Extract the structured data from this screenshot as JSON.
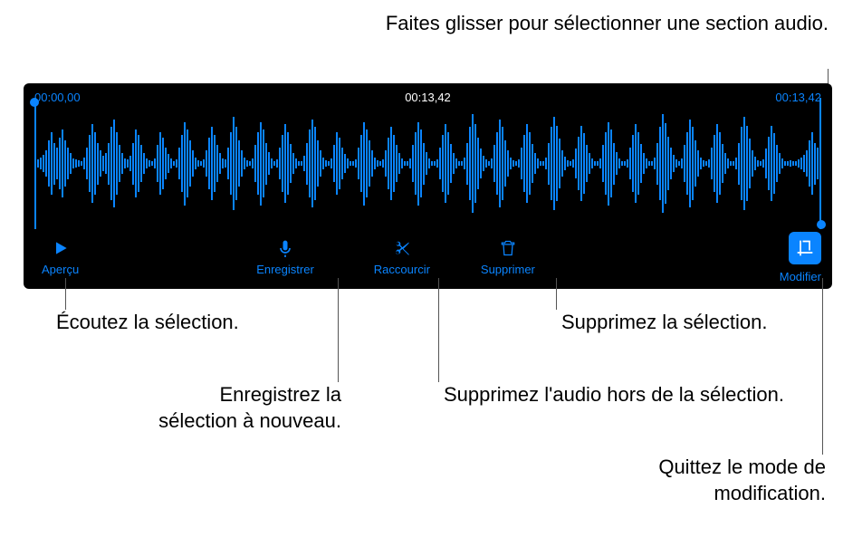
{
  "annotations": {
    "drag_select": "Faites glisser pour sélectionner une section audio.",
    "listen": "Écoutez la sélection.",
    "record_again": "Enregistrez la sélection à nouveau.",
    "delete_outside": "Supprimez l'audio hors de la sélection.",
    "delete_selection": "Supprimez la sélection.",
    "exit_edit": "Quittez le mode de modification."
  },
  "timeline": {
    "start": "00:00,00",
    "current": "00:13,42",
    "end": "00:13,42"
  },
  "toolbar": {
    "apercu": "Aperçu",
    "enregistrer": "Enregistrer",
    "raccourcir": "Raccourcir",
    "supprimer": "Supprimer",
    "modifier": "Modifier"
  }
}
